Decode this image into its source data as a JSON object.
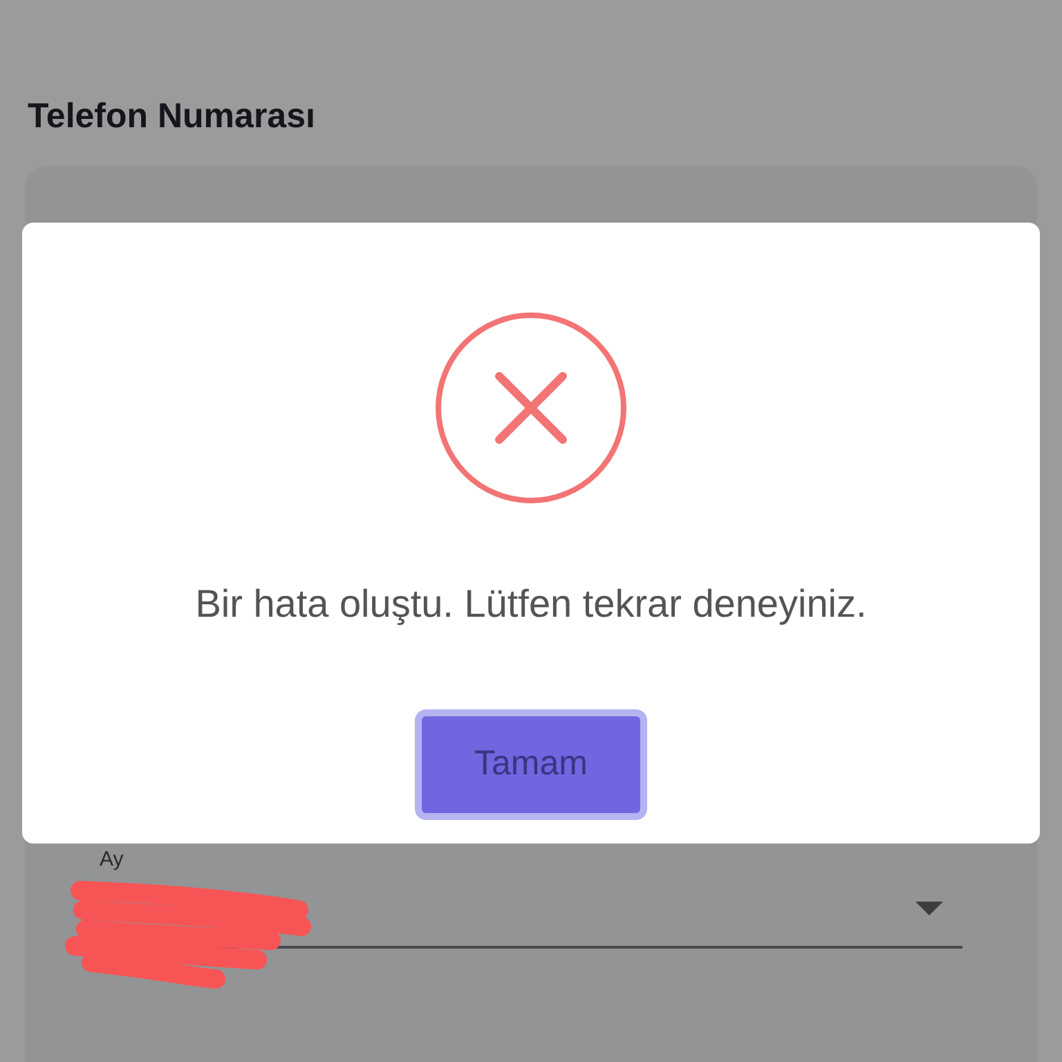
{
  "page": {
    "title": "Telefon Numarası"
  },
  "field": {
    "label": "Ay"
  },
  "dialog": {
    "kind": "error",
    "message": "Bir hata oluştu. Lütfen tekrar deneyiniz.",
    "button": "Tamam"
  }
}
